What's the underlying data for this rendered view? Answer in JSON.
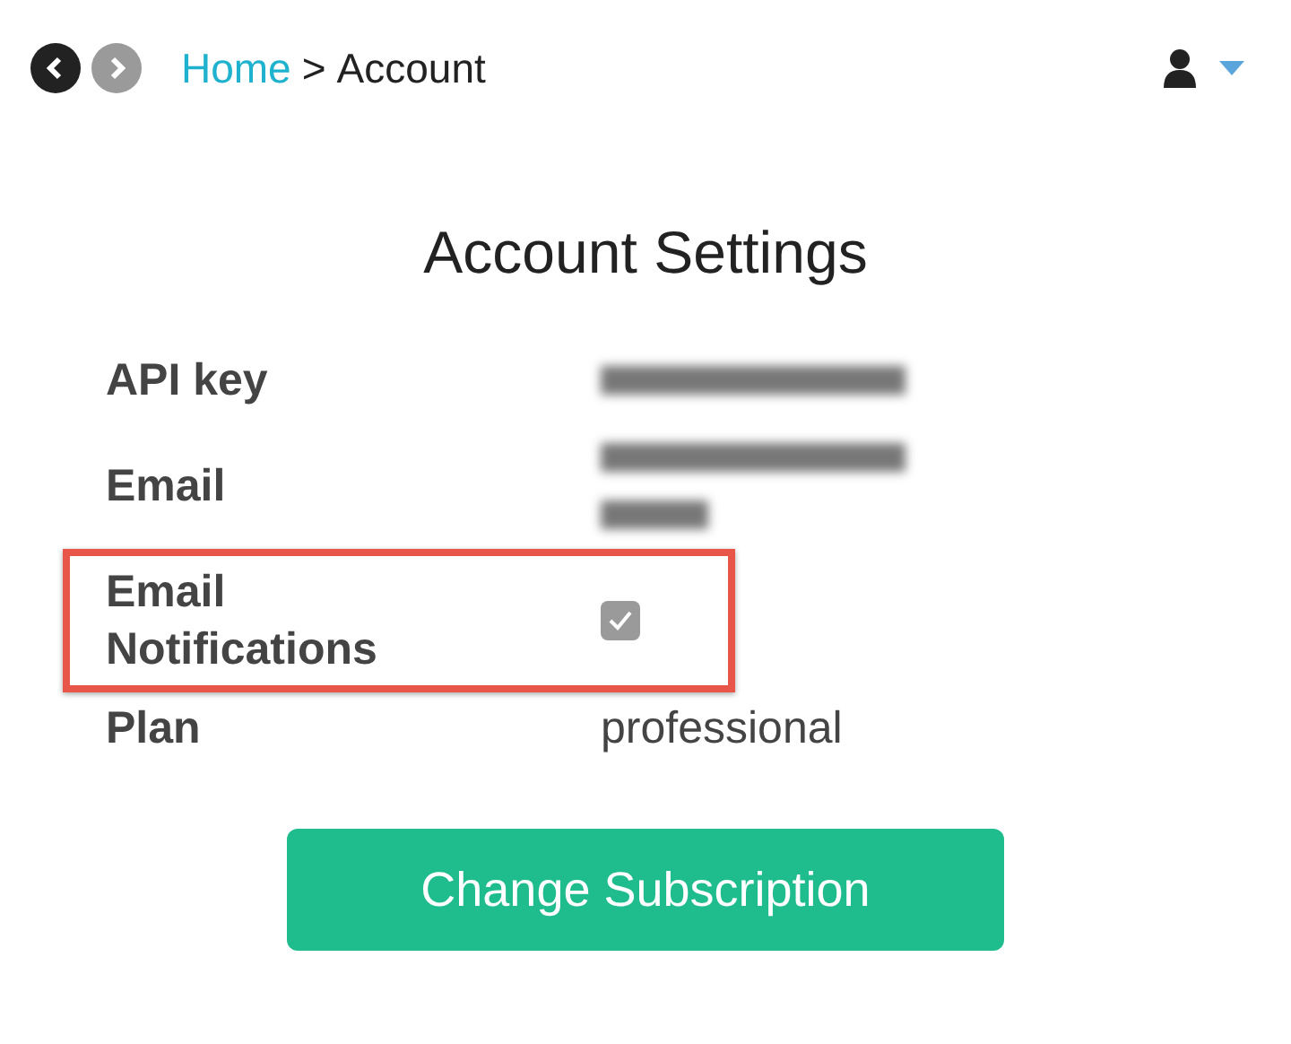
{
  "breadcrumb": {
    "link": "Home",
    "separator": ">",
    "current": "Account"
  },
  "nav": {
    "back_disabled": false,
    "forward_disabled": true
  },
  "title": "Account Settings",
  "rows": [
    {
      "label": "API key",
      "kind": "redacted",
      "highlighted": false
    },
    {
      "label": "Email",
      "kind": "redacted_wrapped",
      "highlighted": false
    },
    {
      "label": "Email Notifications",
      "kind": "checkbox",
      "checked": true,
      "disabled": true,
      "highlighted": true
    },
    {
      "label": "Plan",
      "kind": "text",
      "value": "professional",
      "highlighted": false
    }
  ],
  "button": "Change Subscription"
}
